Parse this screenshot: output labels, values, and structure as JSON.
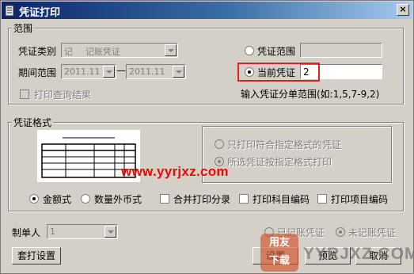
{
  "window": {
    "title": "凭证打印",
    "close_glyph": "×"
  },
  "range_group": {
    "label": "范围",
    "voucher_type_label": "凭证类别",
    "voucher_type_code": "记",
    "voucher_type_name": "记账凭证",
    "period_label": "期间范围",
    "period_from": "2011.11",
    "period_to": "2011.11",
    "period_separator": "—",
    "print_query_label": "打印查询结果",
    "voucher_range_label": "凭证范围",
    "voucher_range_value": "",
    "current_voucher_label": "当前凭证",
    "current_voucher_value": "2",
    "hint": "输入凭证分单范围(如:1,5,7-9,2)"
  },
  "format_group": {
    "label": "凭证格式",
    "print_matching_label": "只打印符合指定格式的凭证",
    "print_selected_label": "所选凭证按指定格式打印",
    "amount_format_label": "金额式",
    "foreign_format_label": "数量外币式",
    "merge_entries_label": "合并打印分录",
    "print_account_code_label": "打印科目编码",
    "print_project_code_label": "打印项目编码"
  },
  "maker": {
    "label": "制单人",
    "value": "1"
  },
  "status": {
    "booked_label": "已记账凭证",
    "unbooked_label": "未记账凭证"
  },
  "buttons": {
    "template": "套打设置",
    "settings": "设置",
    "preview": "预览",
    "cancel": "取消"
  },
  "watermark": {
    "url": "www.yyrjxz.com",
    "logo_top": "用友",
    "logo_bottom": "下载",
    "domain": "YYRJXZ.COM"
  },
  "colors": {
    "title_start": "#0a246a",
    "title_end": "#a6caf0",
    "dialog_bg": "#d4d0c8",
    "highlight": "#e02020",
    "watermark": "#ff0000"
  }
}
